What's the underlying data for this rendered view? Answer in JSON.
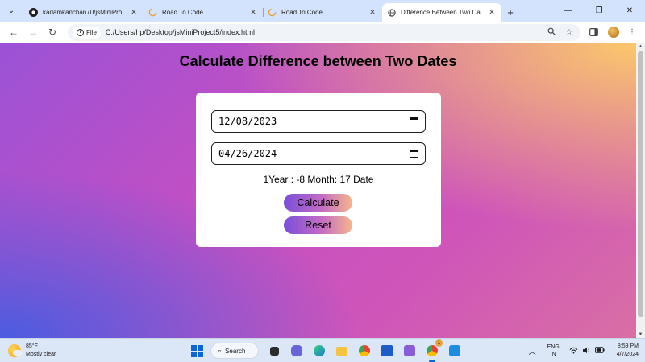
{
  "browser": {
    "tabs": [
      {
        "title": "kadamkanchan70/jsMiniProject",
        "favicon": "github-icon",
        "active": false
      },
      {
        "title": "Road To Code",
        "favicon": "loading-icon",
        "active": false
      },
      {
        "title": "Road To Code",
        "favicon": "loading-icon",
        "active": false
      },
      {
        "title": "Difference Between Two Dates",
        "favicon": "globe-icon",
        "active": true
      }
    ],
    "chip_label": "File",
    "url": "C:/Users/hp/Desktop/jsMiniProject5/index.html"
  },
  "page": {
    "title": "Calculate Difference between Two Dates",
    "date1": "12/08/2023",
    "date2": "04/26/2024",
    "result": "1Year : -8 Month: 17 Date",
    "calculate_label": "Calculate",
    "reset_label": "Reset"
  },
  "taskbar": {
    "temperature": "85°F",
    "weather": "Mostly clear",
    "search_label": "Search",
    "lang_top": "ENG",
    "lang_bottom": "IN",
    "time": "8:59 PM",
    "date": "4/7/2024",
    "chrome_badge": "1"
  },
  "colors": {
    "tabbar": "#d3e3fd",
    "gradient_purple": "#9b52d6",
    "gradient_pink": "#cf55b9",
    "gradient_orange": "#fbc86b",
    "gradient_blue": "#4b5ce0",
    "button_start": "#7a4fd9",
    "button_end": "#f6b58a"
  }
}
